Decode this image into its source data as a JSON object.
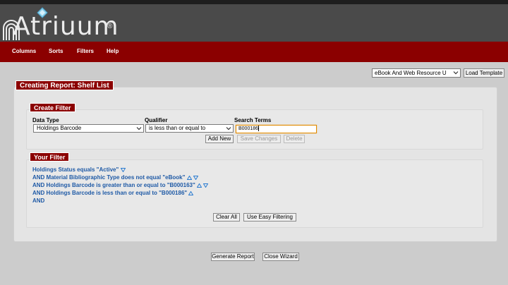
{
  "app": {
    "logo_text": "Atriuum",
    "logo_mark": "®"
  },
  "nav": {
    "items": [
      {
        "label": "Columns"
      },
      {
        "label": "Sorts"
      },
      {
        "label": "Filters"
      },
      {
        "label": "Help"
      }
    ]
  },
  "template": {
    "selected": "eBook And Web Resource U",
    "load_label": "Load Template"
  },
  "report": {
    "title": "Creating Report: Shelf List"
  },
  "create_filter": {
    "title": "Create Filter",
    "data_type_label": "Data Type",
    "data_type_value": "Holdings Barcode",
    "qualifier_label": "Qualifier",
    "qualifier_value": "is less than or equal to",
    "search_terms_label": "Search Terms",
    "search_terms_value": "B000186",
    "add_new_label": "Add New",
    "save_changes_label": "Save Changes",
    "delete_label": "Delete"
  },
  "your_filter": {
    "title": "Your Filter",
    "lines": [
      {
        "text": "Holdings Status equals \"Active\""
      },
      {
        "text": "AND Material Bibliographic Type does not equal \"eBook\""
      },
      {
        "text": "AND Holdings Barcode is greater than or equal to \"B000163\""
      },
      {
        "text": "AND Holdings Barcode is less than or equal to \"B000186\""
      },
      {
        "text": "AND"
      }
    ],
    "clear_all_label": "Clear All",
    "easy_filtering_label": "Use Easy Filtering"
  },
  "footer": {
    "generate_label": "Generate Report",
    "close_label": "Close Wizard"
  },
  "colors": {
    "brand_red": "#8b0000",
    "link_blue": "#1f5aa6",
    "header_gray": "#4a4a4a"
  }
}
